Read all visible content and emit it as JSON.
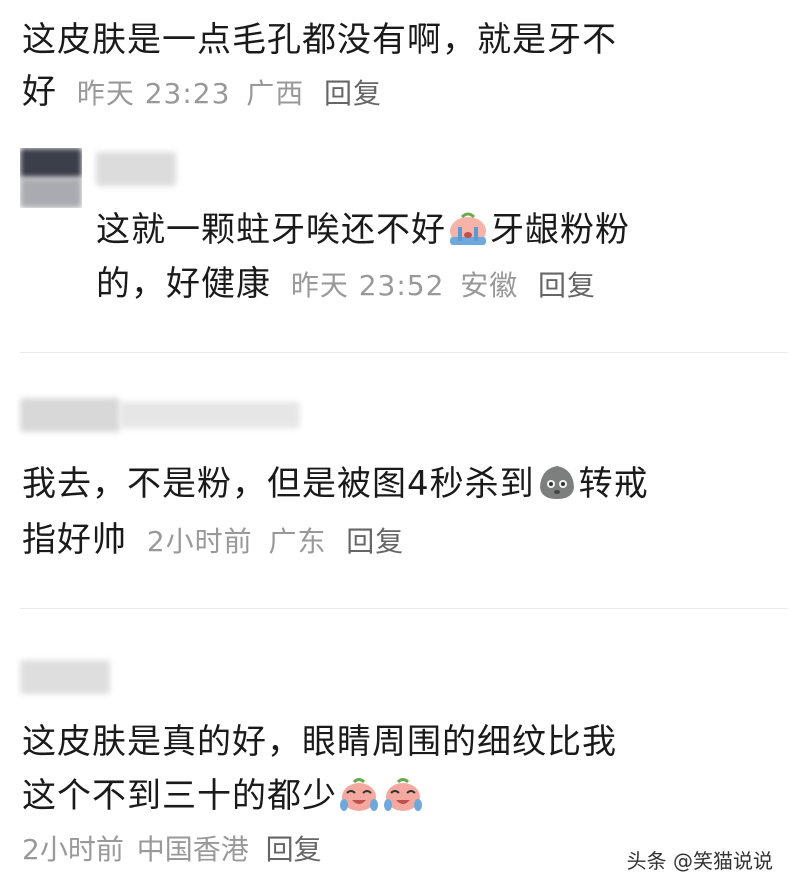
{
  "comments": [
    {
      "line1": "这皮肤是一点毛孔都没有啊，就是牙不",
      "line2_text": "好",
      "time": "昨天 23:23",
      "location": "广西",
      "reply_label": "回复"
    },
    {
      "line1_a": "这就一颗蛀牙唉还不好",
      "line1_b": "牙龈粉粉",
      "line2_text": "的，好健康",
      "time": "昨天 23:52",
      "location": "安徽",
      "reply_label": "回复",
      "emoji": "crying-face-icon"
    },
    {
      "line1_a": "我去，不是粉，但是被图4秒杀到",
      "line1_b": "转戒",
      "line2_text": "指好帅",
      "time": "2小时前",
      "location": "广东",
      "reply_label": "回复",
      "emoji": "gray-blob-face-icon"
    },
    {
      "line1": "这皮肤是真的好，眼睛周围的细纹比我",
      "line2_text": "这个不到三十的都少",
      "time": "2小时前",
      "location": "中国香港",
      "reply_label": "回复",
      "emoji": "laugh-cry-face-icon"
    }
  ],
  "watermark": "头条 @笑猫说说"
}
